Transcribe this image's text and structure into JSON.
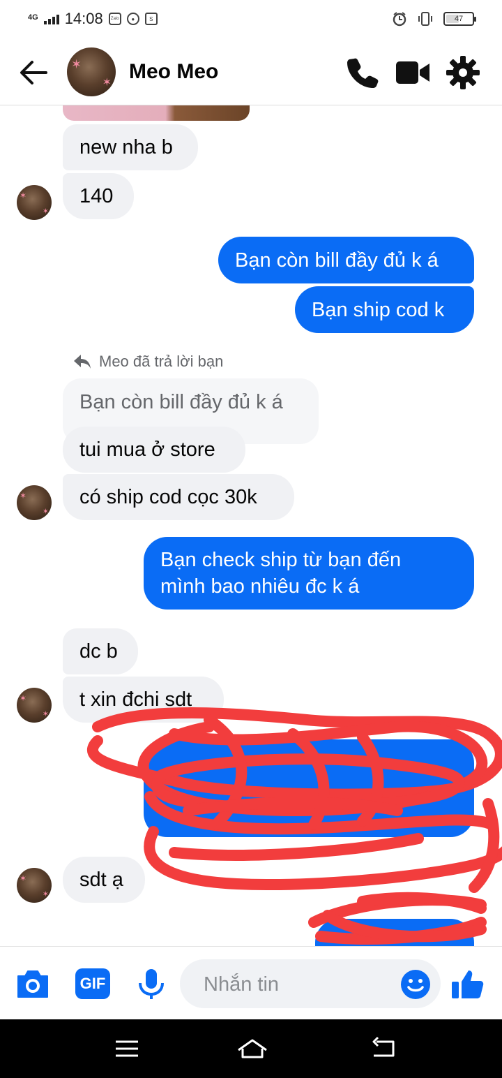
{
  "status_bar": {
    "network": "4G",
    "time": "14:08",
    "app_icon_1": "Zalo",
    "battery": "47"
  },
  "header": {
    "contact_name": "Meo Meo"
  },
  "messages": {
    "m1": "new nha b",
    "m2": "140",
    "m3": "Bạn còn bill đầy đủ k á",
    "m4": "Bạn ship cod k",
    "reply_note": "Meo đã trả lời bạn",
    "quoted": "Bạn còn bill đầy đủ k á",
    "m5": "tui mua ở store",
    "m6": "có ship cod cọc 30k",
    "m7_line1": "Bạn check ship từ bạn đến",
    "m7_line2": "mình bao nhiêu đc k á",
    "m8": "dc b",
    "m9": "t xin đchi sdt",
    "m10": "sdt ạ"
  },
  "composer": {
    "placeholder": "Nhắn tin",
    "gif_label": "GIF"
  },
  "colors": {
    "accent": "#0a6cf5",
    "incoming_bubble": "#f0f1f4",
    "scribble": "#f23d3d"
  },
  "icons": [
    "back-arrow-icon",
    "phone-icon",
    "video-call-icon",
    "gear-icon",
    "camera-icon",
    "gif-icon",
    "microphone-icon",
    "emoji-icon",
    "thumbs-up-icon"
  ]
}
